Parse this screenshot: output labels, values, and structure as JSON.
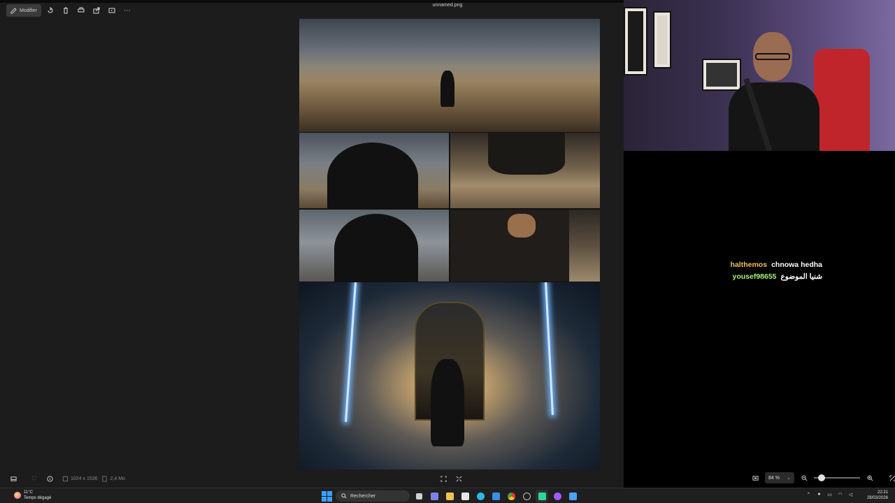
{
  "viewer": {
    "edit_label": "Modifier",
    "filename": "unnamed.png",
    "toolbar_icons": [
      "rotate-icon",
      "delete-icon",
      "print-icon",
      "share-icon",
      "slideshow-icon",
      "more-icon"
    ]
  },
  "status_bar": {
    "dimensions": "1024 x 1536",
    "file_size": "2,4 Mo",
    "zoom": "84 %",
    "zoom_level_percent": 84
  },
  "chat": [
    {
      "user": "halthemos",
      "user_color": "#f0c060",
      "message": "chnowa hedha"
    },
    {
      "user": "yousef98655",
      "user_color": "#a6f07a",
      "message": "شنيا الموضوع"
    }
  ],
  "taskbar": {
    "weather_temp": "11°C",
    "weather_desc": "Temps dégagé",
    "search_placeholder": "Rechercher",
    "time": "22:21",
    "date": "28/03/2026",
    "apps": [
      {
        "name": "task-view",
        "color": "#cfcfcf"
      },
      {
        "name": "teams",
        "color": "#7b83eb"
      },
      {
        "name": "file-explorer",
        "color": "#f2c14e"
      },
      {
        "name": "store",
        "color": "#e6e6e6"
      },
      {
        "name": "edge",
        "color": "#2fb6e8"
      },
      {
        "name": "mail",
        "color": "#3a8ee6"
      },
      {
        "name": "chrome",
        "color": "#4caf50"
      },
      {
        "name": "speed",
        "color": "#bdbdbd"
      },
      {
        "name": "obs",
        "color": "#2bd4a0"
      },
      {
        "name": "messenger",
        "color": "#a05cff"
      },
      {
        "name": "photos",
        "color": "#4aa3ff"
      }
    ]
  }
}
